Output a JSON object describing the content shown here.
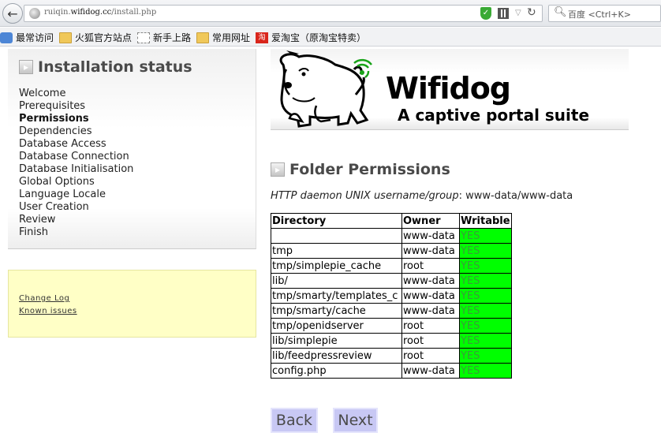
{
  "browser": {
    "url_prefix": "ruiqin.",
    "url_domain": "wifidog.cc",
    "url_path": "/install.php",
    "search_placeholder": "百度 <Ctrl+K>",
    "shield_glyph": "✓",
    "bookmarks": [
      "最常访问",
      "火狐官方站点",
      "新手上路",
      "常用网址",
      "爱淘宝（原淘宝特卖）"
    ],
    "taobao_glyph": "淘"
  },
  "sidebar": {
    "title": "Installation status",
    "items": [
      {
        "label": "Welcome",
        "active": false
      },
      {
        "label": "Prerequisites",
        "active": false
      },
      {
        "label": "Permissions",
        "active": true
      },
      {
        "label": "Dependencies",
        "active": false
      },
      {
        "label": "Database Access",
        "active": false
      },
      {
        "label": "Database Connection",
        "active": false
      },
      {
        "label": "Database Initialisation",
        "active": false
      },
      {
        "label": "Global Options",
        "active": false
      },
      {
        "label": "Language Locale",
        "active": false
      },
      {
        "label": "User Creation",
        "active": false
      },
      {
        "label": "Review",
        "active": false
      },
      {
        "label": "Finish",
        "active": false
      }
    ]
  },
  "notes": {
    "changelog": "Change Log",
    "known_issues": "Known issues"
  },
  "banner": {
    "title": "Wifidog",
    "subtitle": "A captive portal suite"
  },
  "main": {
    "section_title": "Folder Permissions",
    "daemon_label": "HTTP daemon UNIX username/group",
    "daemon_value": "www-data/www-data",
    "table": {
      "headers": [
        "Directory",
        "Owner",
        "Writable"
      ],
      "rows": [
        [
          "",
          "www-data",
          "YES"
        ],
        [
          "tmp",
          "www-data",
          "YES"
        ],
        [
          "tmp/simplepie_cache",
          "root",
          "YES"
        ],
        [
          "lib/",
          "www-data",
          "YES"
        ],
        [
          "tmp/smarty/templates_c",
          "www-data",
          "YES"
        ],
        [
          "tmp/smarty/cache",
          "www-data",
          "YES"
        ],
        [
          "tmp/openidserver",
          "root",
          "YES"
        ],
        [
          "lib/simplepie",
          "root",
          "YES"
        ],
        [
          "lib/feedpressreview",
          "root",
          "YES"
        ],
        [
          "config.php",
          "www-data",
          "YES"
        ]
      ]
    },
    "back_label": "Back",
    "next_label": "Next"
  },
  "colors": {
    "writable_bg": "#00ff00",
    "nav_button_bg": "#c8c8f4",
    "notes_bg": "#ffffc6"
  }
}
